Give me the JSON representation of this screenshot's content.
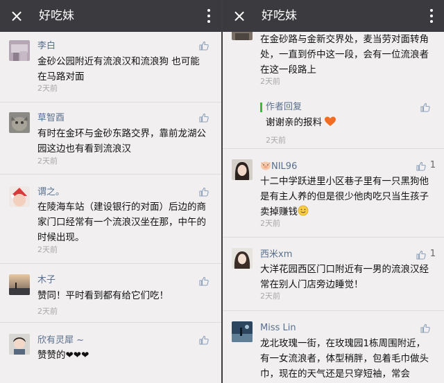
{
  "left": {
    "title": "好吃妹",
    "comments": [
      {
        "name": "李白",
        "text": "金砂公园附近有流浪汉和流浪狗 也可能在马路对面",
        "time": "2天前"
      },
      {
        "name": "草智酉",
        "text": "有时在金环与金砂东路交界，靠前龙湖公园这边也有看到流浪汉",
        "time": "2天前"
      },
      {
        "name": "谓之。",
        "text": "在陵海车站（建设银行的对面）后边的商家门口经常有一个流浪汉坐在那，中午的时候出现。",
        "time": "2天前"
      },
      {
        "name": "木子",
        "text": "赞同！平时看到都有给它们吃！",
        "time": "2天前"
      },
      {
        "name": "欣有灵犀 ~",
        "text": "赞赞的❤❤❤"
      }
    ]
  },
  "right": {
    "title": "好吃妹",
    "comments": [
      {
        "text": "在金砂路与金新交界处，麦当劳对面转角处，一直到侨中这一段，会有一位流浪者在这一段路上",
        "time": "2天前"
      },
      {
        "name": "NIL96",
        "text": "十二中学跃进里小区巷子里有一只黑狗他是有主人养的但是很少他肉吃只当生孩子卖掉赚钱",
        "time": "2天前",
        "likes": "1"
      },
      {
        "name": "西米xm",
        "text": "大洋花园西区门口附近有一男的流浪汉经常在别人门店旁边睡觉！",
        "time": "2天前",
        "likes": "1"
      },
      {
        "name": "Miss Lin",
        "text": "龙北玫瑰一街，在玫瑰园1栋周围附近，有一女流浪者，体型稍胖，包着毛巾做头巾，现在的天气还是只穿短袖，常会"
      }
    ],
    "reply": {
      "label": "作者回复",
      "text": "谢谢亲的报料",
      "time": "2天前"
    }
  },
  "icons": {
    "close": "×",
    "more": "more-vertical-icon",
    "like": "thumbs-up-icon"
  }
}
